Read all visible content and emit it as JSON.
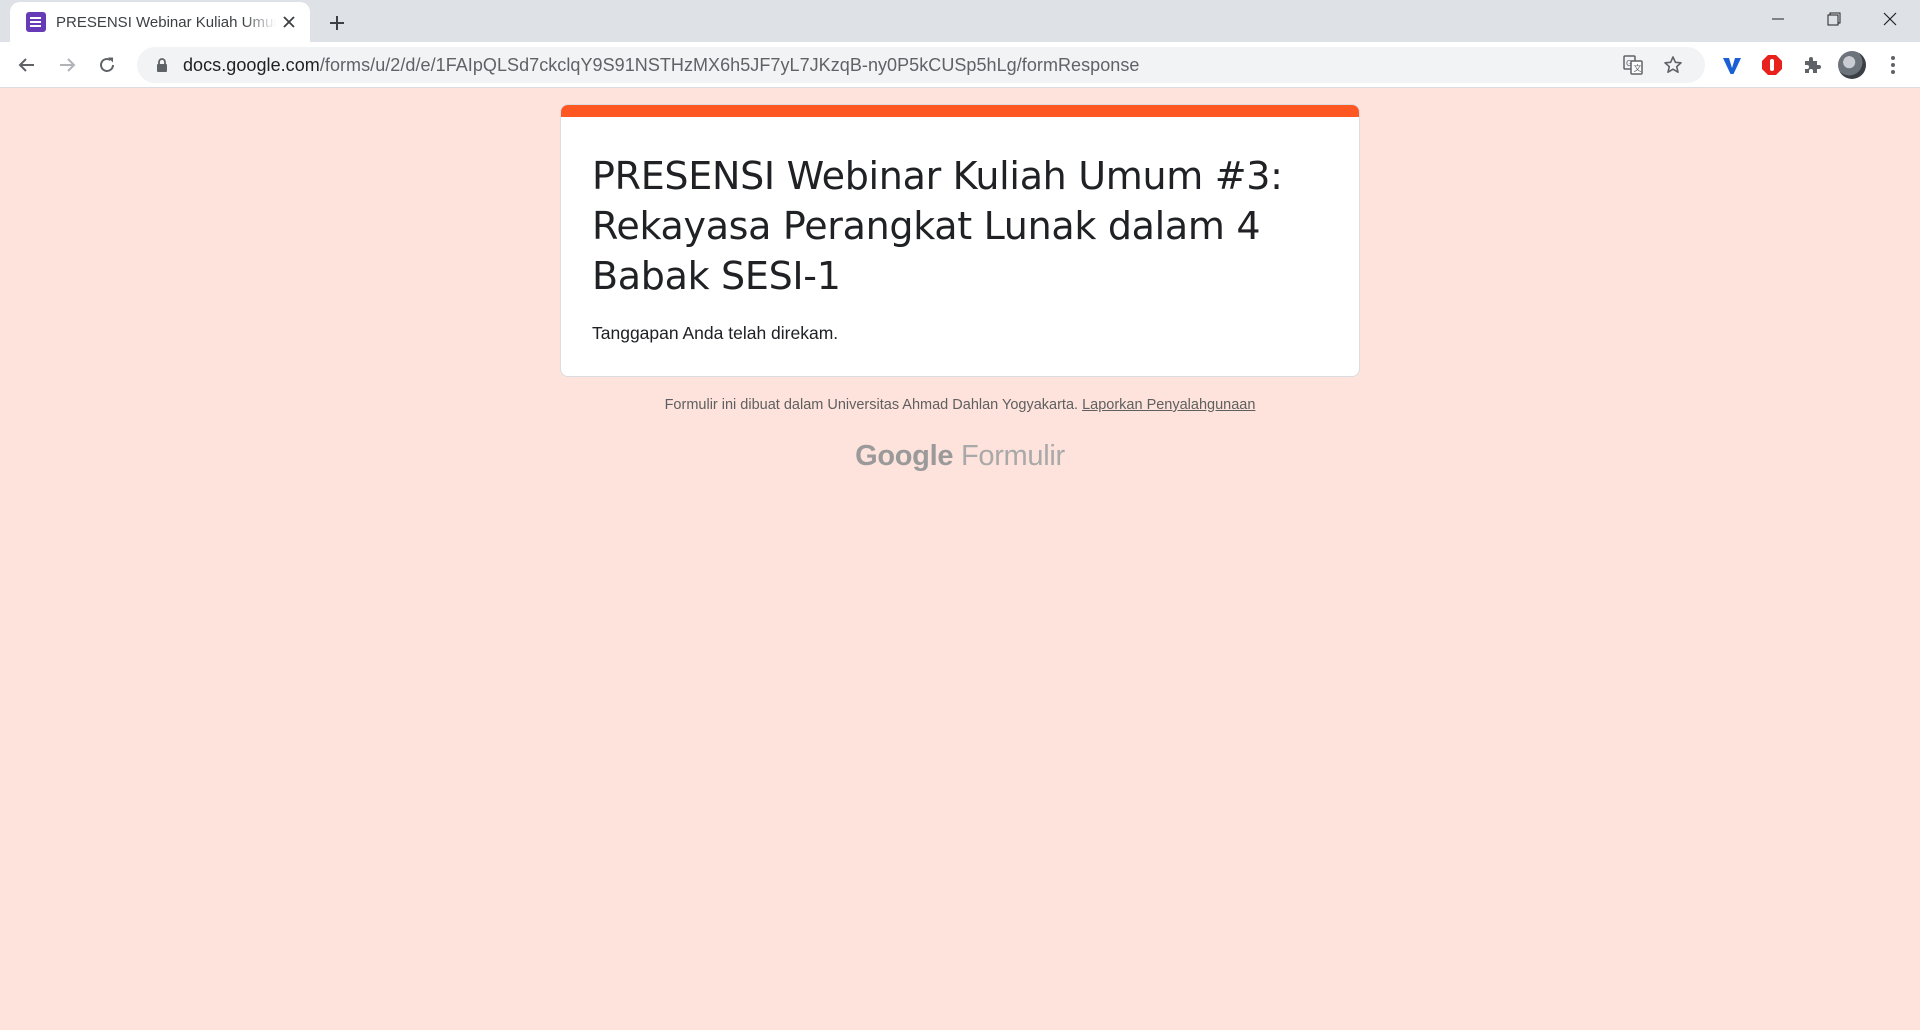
{
  "browser": {
    "tab": {
      "title": "PRESENSI Webinar Kuliah Umum #3: Rekayasa Perangkat Lunak dalam 4 Babak SESI-1",
      "favicon": "google-forms-icon"
    },
    "url_host": "docs.google.com",
    "url_path": "/forms/u/2/d/e/1FAIpQLSd7ckclqY9S91NSTHzMX6h5JF7yL7JKzqB-ny0P5kCUSp5hLg/formResponse"
  },
  "form": {
    "title": "PRESENSI Webinar Kuliah Umum #3: Rekayasa Perangkat Lunak dalam 4 Babak SESI-1",
    "confirmation": "Tanggapan Anda telah direkam.",
    "accent_color": "#ff5722",
    "background_color": "#fde3dc"
  },
  "footer": {
    "note": "Formulir ini dibuat dalam Universitas Ahmad Dahlan Yogyakarta.",
    "report_link": "Laporkan Penyalahgunaan",
    "brand_google": "Google",
    "brand_product": "Formulir"
  }
}
